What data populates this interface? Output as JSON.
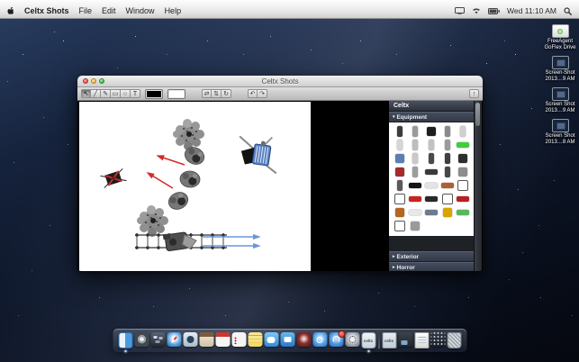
{
  "menu_bar": {
    "app_name": "Celtx Shots",
    "menus": [
      "File",
      "Edit",
      "Window",
      "Help"
    ],
    "status": {
      "clock": "Wed 11:10 AM"
    }
  },
  "desktop_icons": [
    {
      "name": "freeagent-goflex-drive",
      "cls": "drive",
      "line1": "FreeAgent",
      "line2": "GoFlex Drive"
    },
    {
      "name": "screen-shot-1",
      "cls": "shot",
      "line1": "Screen Shot",
      "line2": "2013…9 AM"
    },
    {
      "name": "screen-shot-2",
      "cls": "shot",
      "line1": "Screen Shot",
      "line2": "2013…9 AM"
    },
    {
      "name": "screen-shot-3",
      "cls": "shot",
      "line1": "Screen Shot",
      "line2": "2013…8 AM"
    }
  ],
  "window": {
    "title": "Celtx Shots",
    "toolbar": {
      "tools": [
        {
          "name": "select",
          "glyph": "↖",
          "cls": "on"
        },
        {
          "name": "line",
          "glyph": "╱"
        },
        {
          "name": "pencil",
          "glyph": "✎"
        },
        {
          "name": "rectangle",
          "glyph": "▭"
        },
        {
          "name": "ellipse",
          "glyph": "○"
        },
        {
          "name": "text",
          "glyph": "T"
        }
      ],
      "stroke_well_color": "#000000",
      "fill_well_color": "#ffffff",
      "arrange": [
        {
          "name": "flip-horizontal",
          "glyph": "⇄"
        },
        {
          "name": "flip-vertical",
          "glyph": "⇅"
        },
        {
          "name": "rotate",
          "glyph": "↻"
        }
      ],
      "history": [
        {
          "name": "undo",
          "glyph": "↶"
        },
        {
          "name": "redo",
          "glyph": "↷"
        }
      ],
      "panel_toggle_glyph": "↑"
    },
    "canvas": {
      "arrow_red": "#d42a2a",
      "arrow_blue": "#6b96dd"
    },
    "palette": {
      "header": "Celtx",
      "section_equipment": "Equipment",
      "section_exterior": "Exterior",
      "section_horror": "Horror",
      "disclosure_open": "▾",
      "disclosure_closed": "▸",
      "accent_green": "#3ecf3e",
      "accent_red": "#cc2222",
      "items": [
        {
          "name": "helmet",
          "cls": "t",
          "c": "#3c3c3c"
        },
        {
          "name": "rope-hook",
          "cls": "t",
          "c": "#9a9a9a"
        },
        {
          "name": "tank-top",
          "c": "#1e1e1e"
        },
        {
          "name": "truck",
          "cls": "t",
          "c": "#8a8a8a"
        },
        {
          "name": "ladder",
          "cls": "t",
          "c": "#cfcfcf"
        },
        {
          "name": "ladder-frame",
          "cls": "t",
          "c": "#d6d6d6"
        },
        {
          "name": "rope-curve",
          "cls": "t",
          "c": "#bdbdbd"
        },
        {
          "name": "rope-curve-2",
          "cls": "t",
          "c": "#c2c2c2"
        },
        {
          "name": "truck-2",
          "cls": "t",
          "c": "#9b9b9b"
        },
        {
          "name": "green-bar",
          "cls": "w",
          "c": "#3ecf3e"
        },
        {
          "name": "blue-cap",
          "c": "#5b7fb3"
        },
        {
          "name": "dotted-trail",
          "cls": "t",
          "c": "#c9c9c9"
        },
        {
          "name": "soldier",
          "cls": "t",
          "c": "#4a4a4a"
        },
        {
          "name": "tank-small",
          "cls": "t",
          "c": "#3f3f3f"
        },
        {
          "name": "motorcycle",
          "c": "#2e2e2e"
        },
        {
          "name": "red-helmet",
          "c": "#a52a2a"
        },
        {
          "name": "pole",
          "cls": "t",
          "c": "#9c9c9c"
        },
        {
          "name": "rifle",
          "cls": "w",
          "c": "#3a3a3a"
        },
        {
          "name": "soldier-2",
          "cls": "t",
          "c": "#484848"
        },
        {
          "name": "spider-rig",
          "c": "#8d8d8d"
        },
        {
          "name": "figure",
          "cls": "t",
          "c": "#5a5a5a"
        },
        {
          "name": "black-patch",
          "cls": "w",
          "c": "#141414"
        },
        {
          "name": "white-capsule",
          "cls": "w",
          "c": "#e4e4e4"
        },
        {
          "name": "crate",
          "cls": "w",
          "c": "#b06030"
        },
        {
          "name": "marker-box",
          "cls": "o",
          "c": "#ffffff"
        },
        {
          "name": "white-truck",
          "cls": "o",
          "c": "#f4f4f4"
        },
        {
          "name": "red-bar",
          "cls": "w",
          "c": "#cc2222"
        },
        {
          "name": "dark-capsule",
          "cls": "w",
          "c": "#2a2a2a"
        },
        {
          "name": "white-van",
          "cls": "o",
          "c": "#efefef"
        },
        {
          "name": "red-box",
          "cls": "w",
          "c": "#bb2020"
        },
        {
          "name": "brown-box",
          "c": "#b5651d"
        },
        {
          "name": "white-arrow",
          "cls": "w",
          "c": "#e8e8e8"
        },
        {
          "name": "gray-bar",
          "cls": "w",
          "c": "#6b7b8c"
        },
        {
          "name": "torch",
          "c": "#d9a400"
        },
        {
          "name": "green-capsule",
          "cls": "w",
          "c": "#58b858"
        },
        {
          "name": "white-cart",
          "cls": "o",
          "c": "#ececec"
        },
        {
          "name": "cross-figure",
          "c": "#9a9a9a"
        }
      ]
    }
  },
  "dock": {
    "items": [
      {
        "name": "finder",
        "cls": "finder",
        "running": true
      },
      {
        "name": "launchpad",
        "cls": "launchpad"
      },
      {
        "name": "mission-control",
        "cls": "mission"
      },
      {
        "name": "safari",
        "cls": "safari"
      },
      {
        "name": "mail",
        "cls": "mail"
      },
      {
        "name": "contacts",
        "cls": "contacts"
      },
      {
        "name": "calendar",
        "cls": "calendar"
      },
      {
        "name": "reminders",
        "cls": "reminders"
      },
      {
        "name": "notes",
        "cls": "notes"
      },
      {
        "name": "messages",
        "cls": "messages"
      },
      {
        "name": "facetime",
        "cls": "facetime"
      },
      {
        "name": "photo-booth",
        "cls": "photobooth"
      },
      {
        "name": "itunes",
        "cls": "itunes"
      },
      {
        "name": "app-store",
        "cls": "appstore"
      },
      {
        "name": "system-preferences",
        "cls": "sysprefs"
      },
      {
        "name": "celtx",
        "cls": "celtx",
        "label": "celtx",
        "running": true
      },
      {
        "name": "separator",
        "cls": "sep"
      },
      {
        "name": "celtx-project",
        "cls": "celtxdoc",
        "label": "celtx"
      },
      {
        "name": "folder-stack",
        "cls": "folderstack"
      },
      {
        "name": "documents-stack",
        "cls": "docstack"
      },
      {
        "name": "applications-stack",
        "cls": "appstack"
      },
      {
        "name": "trash",
        "cls": "trash"
      }
    ]
  }
}
